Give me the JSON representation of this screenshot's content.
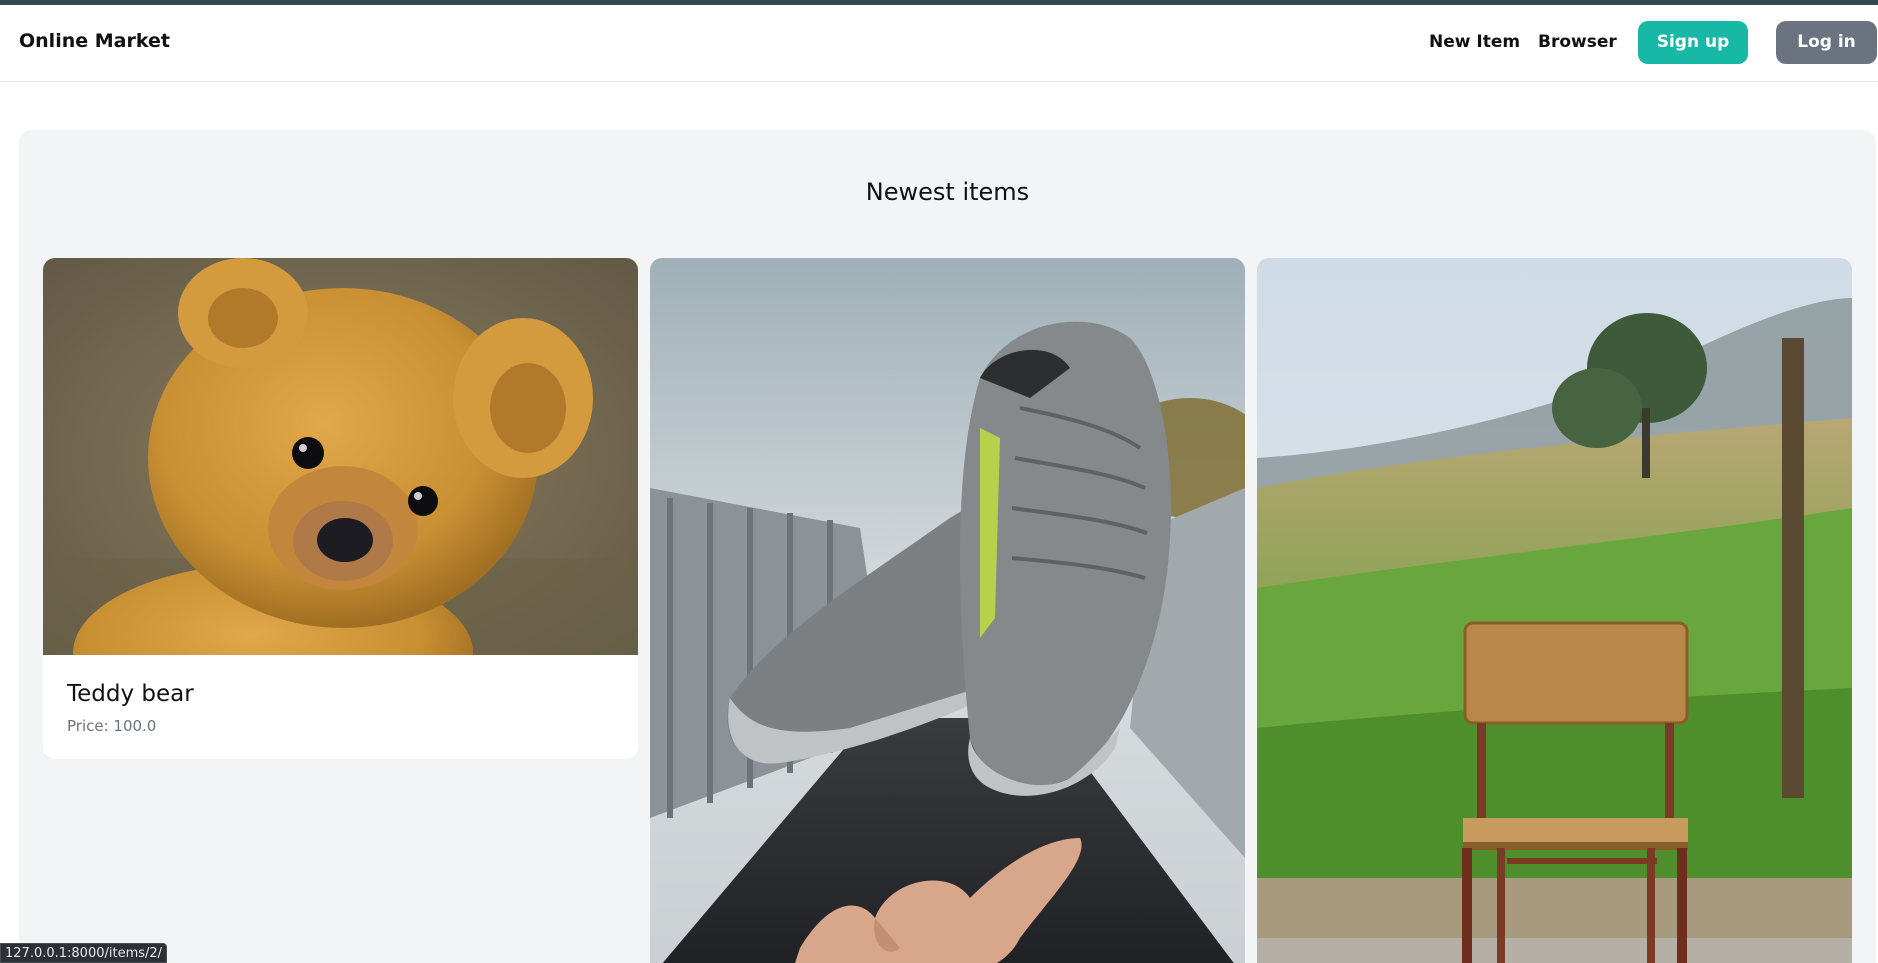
{
  "header": {
    "brand": "Online Market",
    "nav": {
      "new_item": "New Item",
      "browser": "Browser",
      "sign_up": "Sign up",
      "log_in": "Log in"
    }
  },
  "main": {
    "title": "Newest items",
    "items": [
      {
        "name": "Teddy bear",
        "price_text": "Price: 100.0",
        "image": "teddy-bear-photo"
      },
      {
        "name": "",
        "price_text": "",
        "image": "sneakers-photo"
      },
      {
        "name": "",
        "price_text": "",
        "image": "wooden-chair-photo"
      }
    ]
  },
  "status_bar": {
    "url": "127.0.0.1:8000/items/2/"
  },
  "colors": {
    "top_strip": "#37474f",
    "signup_button": "#17b8a6",
    "login_button": "#6b7280",
    "panel_bg": "#f3f4f6",
    "price_text": "#6b7280"
  }
}
